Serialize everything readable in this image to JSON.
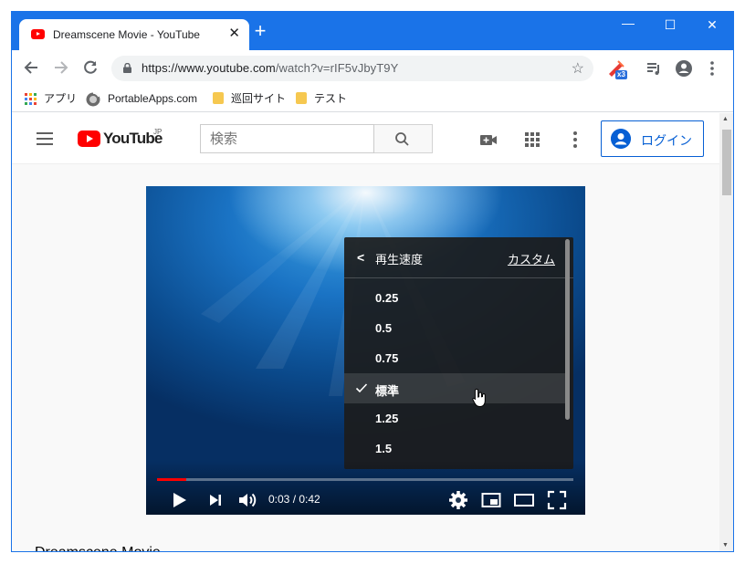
{
  "tab": {
    "title": "Dreamscene Movie - YouTube",
    "close": "✕",
    "new_tab": "+"
  },
  "window_controls": {
    "minimize": "—",
    "maximize": "☐",
    "close": "✕"
  },
  "address_bar": {
    "url_host": "https://www.youtube.com",
    "url_path": "/watch?v=rIF5vJbyT9Y"
  },
  "extension": {
    "badge": "x3"
  },
  "bookmarks": [
    {
      "label": "アプリ",
      "icon": "apps-grid-icon"
    },
    {
      "label": "PortableApps.com",
      "icon": "portableapps-icon"
    },
    {
      "label": "巡回サイト",
      "icon": "folder-icon"
    },
    {
      "label": "テスト",
      "icon": "folder-icon"
    }
  ],
  "youtube": {
    "logo_text": "YouTube",
    "logo_region": "JP",
    "search_placeholder": "検索",
    "login_label": "ログイン",
    "brand_color": "#ff0000",
    "link_color": "#065fd4"
  },
  "speed_menu": {
    "title": "再生速度",
    "custom": "カスタム",
    "options": [
      {
        "label": "0.25",
        "selected": false
      },
      {
        "label": "0.5",
        "selected": false
      },
      {
        "label": "0.75",
        "selected": false
      },
      {
        "label": "標準",
        "selected": true
      },
      {
        "label": "1.25",
        "selected": false
      },
      {
        "label": "1.5",
        "selected": false
      }
    ]
  },
  "player": {
    "time": "0:03 / 0:42",
    "progress": 0.071
  },
  "video": {
    "title": "Dreamscene Movie"
  }
}
